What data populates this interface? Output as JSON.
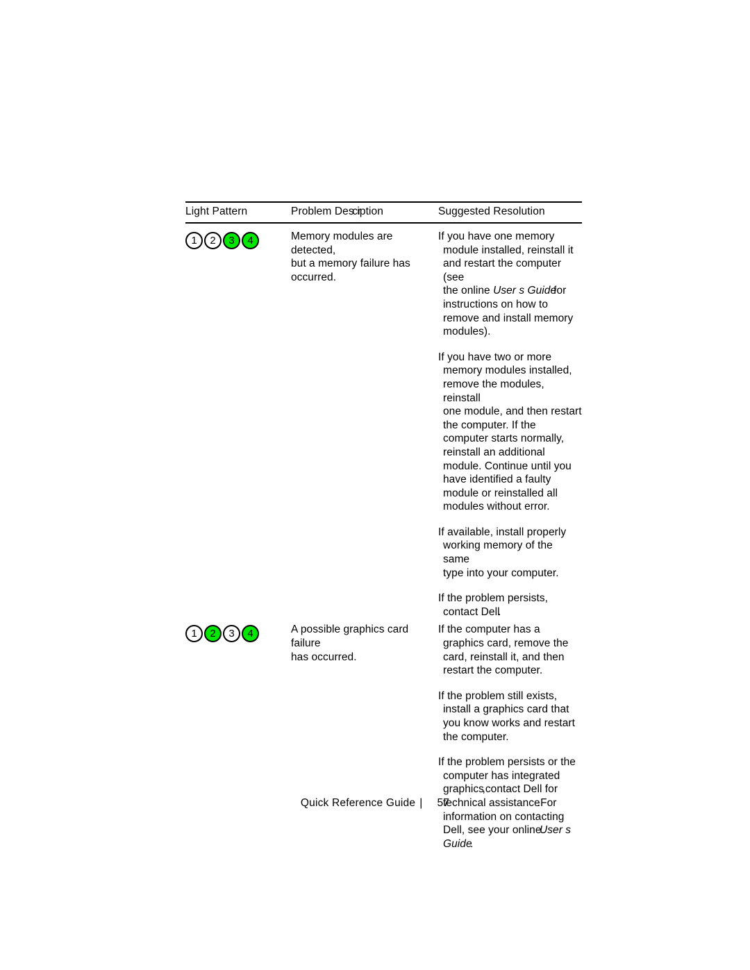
{
  "document": {
    "title": "Quick Reference Guide",
    "page_number": "57"
  },
  "table": {
    "headers": {
      "light_pattern": "Light Pattern",
      "problem_description_a": "Problem Des",
      "problem_description_b": "cr",
      "problem_description_c": "iption",
      "suggested_resolution": "Suggested Resolution"
    },
    "rows": [
      {
        "lights": [
          {
            "number": "1",
            "state": "off"
          },
          {
            "number": "2",
            "state": "off"
          },
          {
            "number": "3",
            "state": "on"
          },
          {
            "number": "4",
            "state": "on"
          }
        ],
        "problem": {
          "line1": "Memory modules are detected,",
          "line2": "but a memory failure has",
          "line3": "occurred."
        },
        "resolution": {
          "p1_line1": "If you have one memory",
          "p1_line2": "module installed, reinstall it",
          "p1_line3": "and restart the computer (see",
          "p1_line4_a": "the online ",
          "p1_line4_italic": "User s Guide",
          "p1_line4_b": "for",
          "p1_line5": "instructions on how to",
          "p1_line6": "remove and install memory",
          "p1_line7": "modules).",
          "p2_line1": "If you have two or more",
          "p2_line2": "memory modules installed,",
          "p2_line3": "remove the modules, reinstall",
          "p2_line4": "one module, and then restart",
          "p2_line5": "the computer. If the",
          "p2_line6": "computer starts normally,",
          "p2_line7": "reinstall an additional",
          "p2_line8": "module. Continue until you",
          "p2_line9": "have identified a faulty",
          "p2_line10": "module or reinstalled all",
          "p2_line11": "modules without error.",
          "p3_line1": "If available, install properly",
          "p3_line2": "working memory of the same",
          "p3_line3": "type into your computer.",
          "p4_line1": "If the problem persists,",
          "p4_line2_a": "contact Dell",
          "p4_line2_b": "."
        }
      },
      {
        "lights": [
          {
            "number": "1",
            "state": "off"
          },
          {
            "number": "2",
            "state": "on"
          },
          {
            "number": "3",
            "state": "off"
          },
          {
            "number": "4",
            "state": "on"
          }
        ],
        "problem": {
          "line1": "A possible graphics card failure",
          "line2": "has occurred."
        },
        "resolution": {
          "p1_line1": "If the computer has a",
          "p1_line2": "graphics card, remove the",
          "p1_line3": "card, reinstall it, and then",
          "p1_line4": "restart the computer.",
          "p2_line1": "If the problem still exists,",
          "p2_line2": "install a graphics card that",
          "p2_line3": "you know works and restart",
          "p2_line4": "the computer.",
          "p3_line1": "If the problem persists or the",
          "p3_line2": "computer has integrated",
          "p3_line3_a": "graphics",
          "p3_line3_b": ",contact Dell for",
          "p3_line4_a": "technical assistance",
          "p3_line4_b": ".For",
          "p3_line5": "information on contacting",
          "p3_line6_a": "Dell, see your online",
          "p3_line6_italic": "User s",
          "p3_line7_italic": "Guide",
          "p3_line7_b": "."
        }
      }
    ]
  },
  "footer": {
    "guide_label": "Quick Reference Guide",
    "separator": "|",
    "page_number": "57"
  },
  "colors": {
    "lamp_on": "#00e800",
    "lamp_off": "#ffffff",
    "lamp_border": "#000000",
    "text": "#000000",
    "page_background": "#ffffff"
  }
}
